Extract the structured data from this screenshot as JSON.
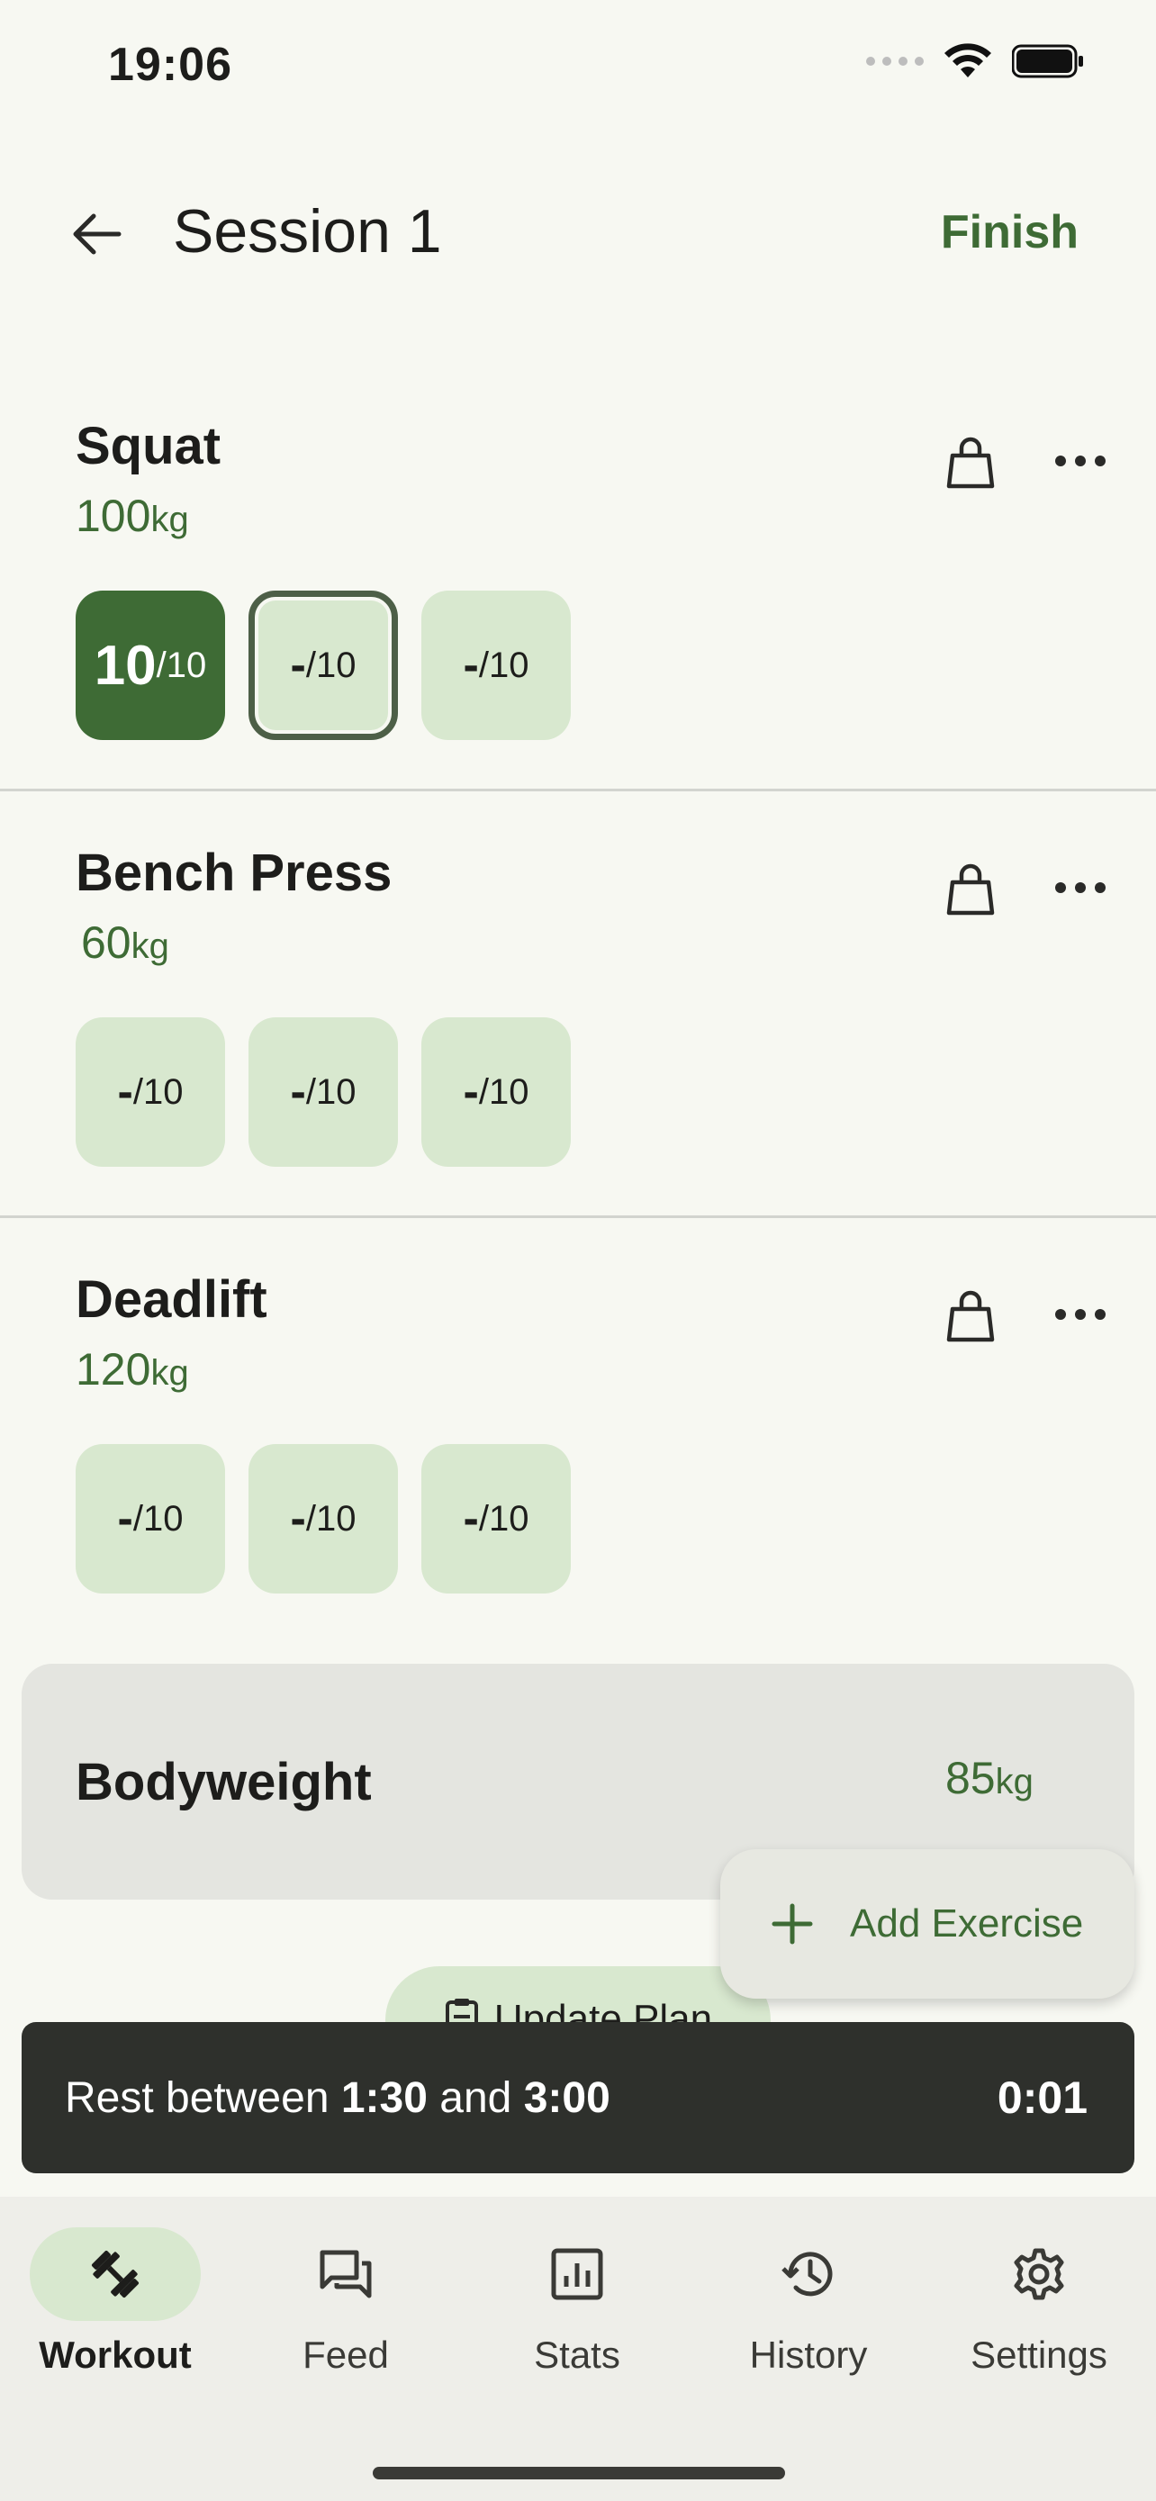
{
  "status_bar": {
    "time": "19:06"
  },
  "header": {
    "title": "Session 1",
    "finish_label": "Finish"
  },
  "exercises": [
    {
      "name": "Squat",
      "weight": "100",
      "unit": "kg",
      "sets": [
        {
          "reps": "10",
          "target": "/10",
          "state": "done"
        },
        {
          "reps": "-",
          "target": "/10",
          "state": "current"
        },
        {
          "reps": "-",
          "target": "/10",
          "state": "pending"
        }
      ]
    },
    {
      "name": "Bench Press",
      "weight": "60",
      "unit": "kg",
      "sets": [
        {
          "reps": "-",
          "target": "/10",
          "state": "pending"
        },
        {
          "reps": "-",
          "target": "/10",
          "state": "pending"
        },
        {
          "reps": "-",
          "target": "/10",
          "state": "pending"
        }
      ]
    },
    {
      "name": "Deadlift",
      "weight": "120",
      "unit": "kg",
      "sets": [
        {
          "reps": "-",
          "target": "/10",
          "state": "pending"
        },
        {
          "reps": "-",
          "target": "/10",
          "state": "pending"
        },
        {
          "reps": "-",
          "target": "/10",
          "state": "pending"
        }
      ]
    }
  ],
  "bodyweight": {
    "label": "Bodyweight",
    "value": "85",
    "unit": "kg"
  },
  "update_plan_label": "Update Plan",
  "add_exercise_label": "Add Exercise",
  "rest": {
    "prefix": "Rest between ",
    "min": "1:30",
    "and": " and ",
    "max": "3:00",
    "timer": "0:01"
  },
  "nav": [
    {
      "label": "Workout",
      "icon": "dumbbell-icon",
      "active": true
    },
    {
      "label": "Feed",
      "icon": "chat-bubbles-icon",
      "active": false
    },
    {
      "label": "Stats",
      "icon": "bar-chart-icon",
      "active": false
    },
    {
      "label": "History",
      "icon": "history-icon",
      "active": false
    },
    {
      "label": "Settings",
      "icon": "gear-icon",
      "active": false
    }
  ],
  "colors": {
    "accent": "#3e6b35",
    "set_bg": "#d8e8cf",
    "background": "#f7f8f2",
    "banner": "#2e302c"
  }
}
